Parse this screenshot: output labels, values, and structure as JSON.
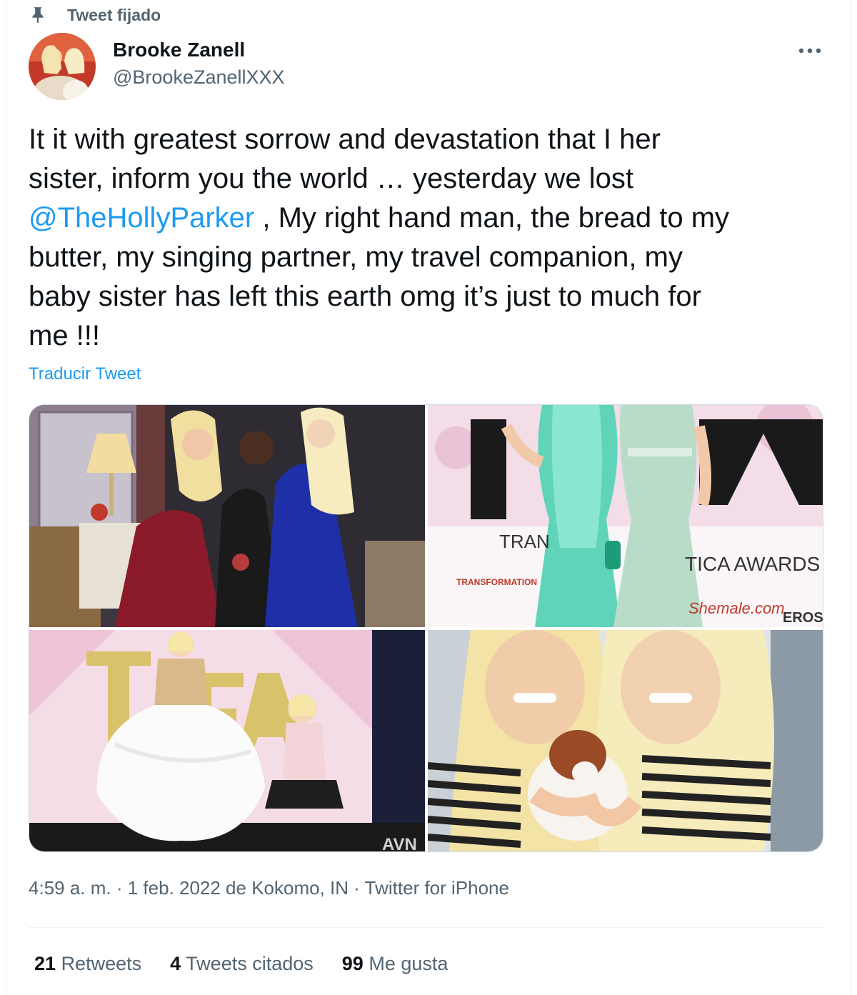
{
  "pinned": {
    "label": "Tweet fijado",
    "icon": "pin-icon"
  },
  "author": {
    "name": "Brooke Zanell",
    "handle": "@BrookeZanellXXX",
    "avatar_icon": "avatar-photo"
  },
  "tweet": {
    "line1": "It it with greatest sorrow and devastation that I her",
    "line2": "sister, inform you the world … yesterday we lost",
    "mention": "@TheHollyParker",
    "line3_rest": " , My right hand man, the bread to my",
    "line4": "butter, my singing partner, my travel companion, my",
    "line5": "baby sister has left this earth omg it’s just to much for",
    "line6": "me !!!"
  },
  "translate_label": "Traducir Tweet",
  "media": {
    "photo2": {
      "sign_left": "TRAN",
      "sign_right": "TICA AWARDS",
      "sponsor1": "TRANSFORMATION",
      "sponsor2": "Shemale.com",
      "sponsor3": "EROS"
    },
    "photo3": {
      "watermark": "AVN"
    }
  },
  "meta": {
    "text": "4:59 a. m. · 1 feb. 2022 de Kokomo, IN · Twitter for iPhone"
  },
  "stats": [
    {
      "count": "21",
      "label": "Retweets"
    },
    {
      "count": "4",
      "label": "Tweets citados"
    },
    {
      "count": "99",
      "label": "Me gusta"
    }
  ],
  "colors": {
    "link": "#1d9bf0",
    "secondary_text": "#536471",
    "primary_text": "#0f1419"
  }
}
